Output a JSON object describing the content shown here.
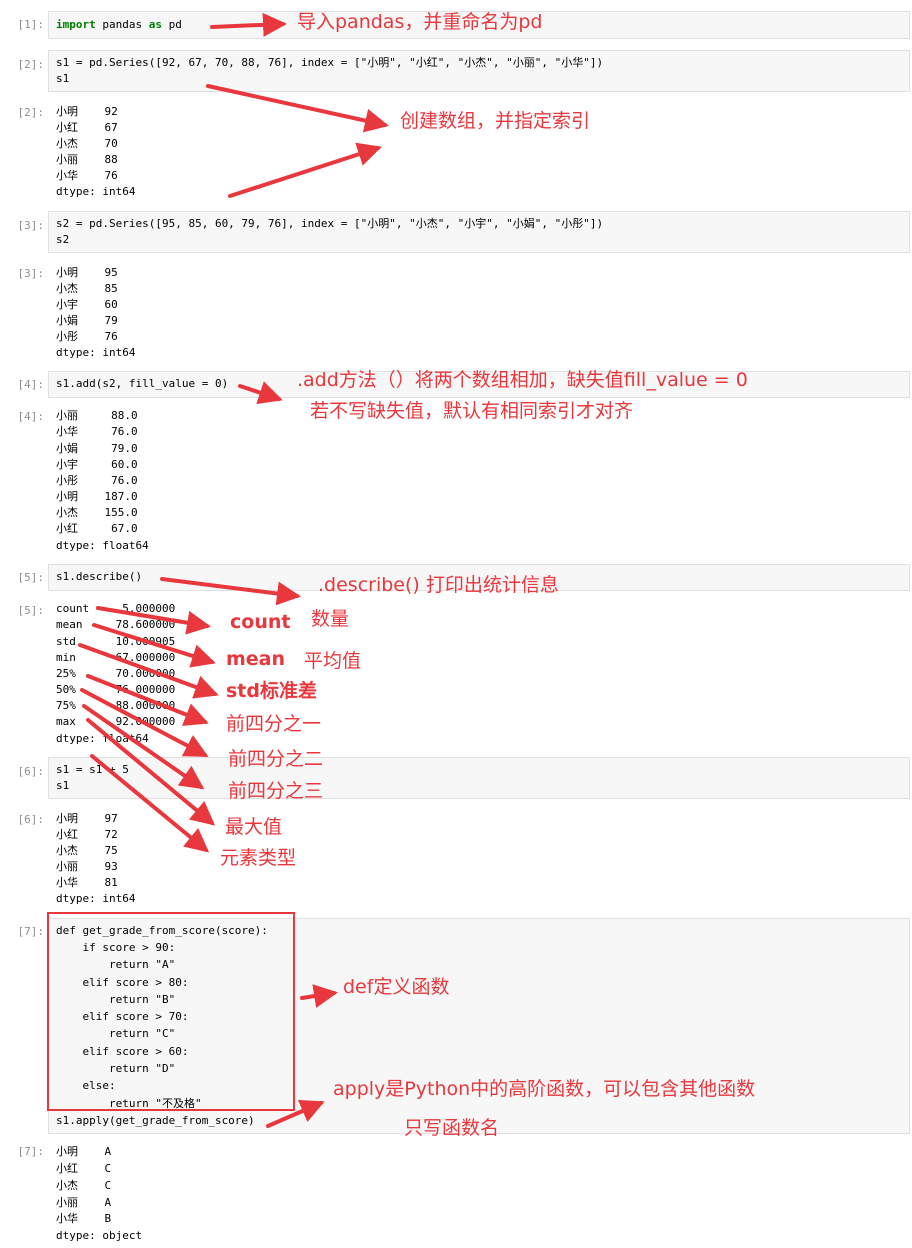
{
  "prompts": [
    "[1]:",
    "[2]:",
    "[2]:",
    "[3]:",
    "[3]:",
    "[4]:",
    "[4]:",
    "[5]:",
    "[5]:",
    "[6]:",
    "[6]:",
    "[7]:",
    "[7]:"
  ],
  "cells": {
    "c1": {
      "code": "import pandas as pd"
    },
    "c2": {
      "line1": "s1 = pd.Series([92, 67, 70, 88, 76], index = [\"小明\", \"小红\", \"小杰\", \"小丽\", \"小华\"])",
      "line2": "s1",
      "out": [
        "小明    92",
        "小红    67",
        "小杰    70",
        "小丽    88",
        "小华    76",
        "dtype: int64"
      ]
    },
    "c3": {
      "line1": "s2 = pd.Series([95, 85, 60, 79, 76], index = [\"小明\", \"小杰\", \"小宇\", \"小娟\", \"小彤\"])",
      "line2": "s2",
      "out": [
        "小明    95",
        "小杰    85",
        "小宇    60",
        "小娟    79",
        "小彤    76",
        "dtype: int64"
      ]
    },
    "c4": {
      "line1": "s1.add(s2, fill_value = 0)",
      "out": [
        "小丽     88.0",
        "小华     76.0",
        "小娟     79.0",
        "小宇     60.0",
        "小彤     76.0",
        "小明    187.0",
        "小杰    155.0",
        "小红     67.0",
        "dtype: float64"
      ]
    },
    "c5": {
      "line1": "s1.describe()",
      "out": [
        "count     5.000000",
        "mean     78.600000",
        "std      10.000905",
        "min      67.000000",
        "25%      70.000000",
        "50%      76.000000",
        "75%      88.000000",
        "max      92.000000",
        "dtype: float64"
      ]
    },
    "c6": {
      "line1": "s1 = s1 + 5",
      "line2": "s1",
      "out": [
        "小明    97",
        "小红    72",
        "小杰    75",
        "小丽    93",
        "小华    81",
        "dtype: int64"
      ]
    },
    "c7": {
      "lines": [
        "def get_grade_from_score(score):",
        "    if score > 90:",
        "        return \"A\"",
        "    elif score > 80:",
        "        return \"B\"",
        "    elif score > 70:",
        "        return \"C\"",
        "    elif score > 60:",
        "        return \"D\"",
        "    else:",
        "        return \"不及格\"",
        "s1.apply(get_grade_from_score)"
      ],
      "out": [
        "小明    A",
        "小红    C",
        "小杰    C",
        "小丽    A",
        "小华    B",
        "dtype: object"
      ]
    }
  },
  "annotations": {
    "import_note": "导入pandas，并重命名为pd",
    "series_note": "创建数组，并指定索引",
    "add_note1": ".add方法（）将两个数组相加，缺失值fill_value = 0",
    "add_note2": "若不写缺失值，默认有相同索引才对齐",
    "describe_note": ".describe() 打印出统计信息",
    "count_en": "count",
    "count_cn": "数量",
    "mean_en": "mean",
    "mean_cn": "平均值",
    "std_note": "std标准差",
    "q1_note": "前四分之一",
    "q2_note": "前四分之二",
    "q3_note": "前四分之三",
    "max_note": "最大值",
    "dtype_note": "元素类型",
    "def_note": "def定义函数",
    "apply_note1": "apply是Python中的高阶函数，可以包含其他函数",
    "apply_note2": "只写函数名"
  },
  "colors": {
    "annotation": "#e8373d",
    "cell_bg": "#f7f7f7",
    "prompt": "#8f8f8f"
  }
}
